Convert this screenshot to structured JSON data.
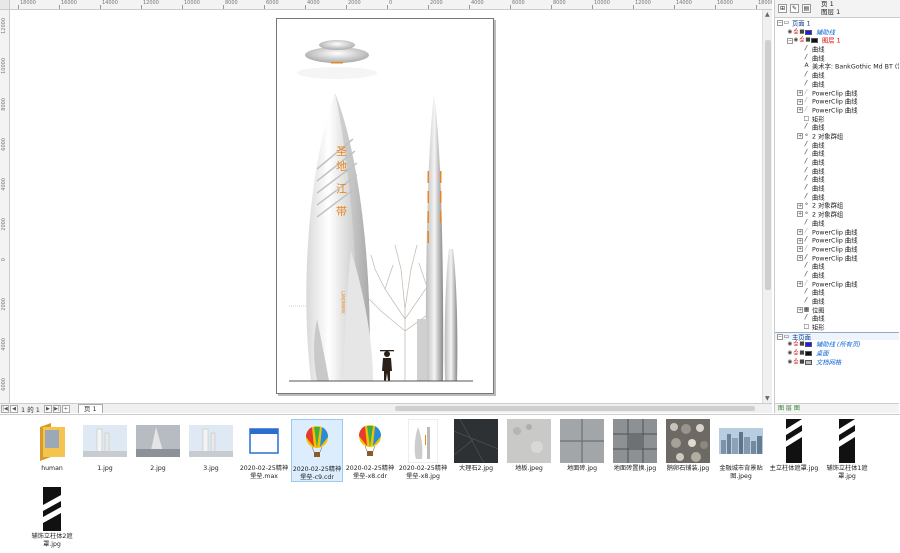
{
  "rulers": {
    "horizontal_labels": [
      "18000",
      "16000",
      "14000",
      "12000",
      "10000",
      "8000",
      "6000",
      "4000",
      "2000",
      "0",
      "2000",
      "4000",
      "6000",
      "8000",
      "10000",
      "12000",
      "14000",
      "16000",
      "18000"
    ],
    "vertical_labels": [
      "12000",
      "10000",
      "8000",
      "6000",
      "4000",
      "2000",
      "0",
      "2000",
      "4000",
      "6000"
    ]
  },
  "artwork": {
    "title_text": "圣地 江 带",
    "side_text": "LANDMARK"
  },
  "page_nav": {
    "counter": "1 的 1",
    "tab_label": "页 1"
  },
  "object_manager": {
    "page_label": "页 1",
    "layer_label": "图层 1",
    "rows": [
      {
        "type": "page",
        "label": "页面 1",
        "expander": "−",
        "icon": "page"
      },
      {
        "type": "layer",
        "label": "辅助线",
        "style": "blue",
        "swatch": "#1a1aff"
      },
      {
        "type": "layer",
        "label": "图层 1",
        "style": "red",
        "swatch": "#111111",
        "expander": "−"
      },
      {
        "type": "obj",
        "label": "曲线",
        "icon": "curve"
      },
      {
        "type": "obj",
        "label": "曲线",
        "icon": "curve"
      },
      {
        "type": "obj",
        "label": "美术字: BankGothic Md BT (常规",
        "icon": "text"
      },
      {
        "type": "obj",
        "label": "曲线",
        "icon": "curve"
      },
      {
        "type": "obj",
        "label": "曲线",
        "icon": "curve"
      },
      {
        "type": "obj",
        "label": "PowerClip 曲线",
        "icon": "curve-light",
        "expander": "+"
      },
      {
        "type": "obj",
        "label": "PowerClip 曲线",
        "icon": "curve-light",
        "expander": "+"
      },
      {
        "type": "obj",
        "label": "PowerClip 曲线",
        "icon": "curve-light",
        "expander": "+"
      },
      {
        "type": "obj",
        "label": "矩形",
        "icon": "rect"
      },
      {
        "type": "obj",
        "label": "曲线",
        "icon": "curve"
      },
      {
        "type": "obj",
        "label": "2 对象群组",
        "icon": "group",
        "expander": "+"
      },
      {
        "type": "obj",
        "label": "曲线",
        "icon": "curve"
      },
      {
        "type": "obj",
        "label": "曲线",
        "icon": "curve"
      },
      {
        "type": "obj",
        "label": "曲线",
        "icon": "curve"
      },
      {
        "type": "obj",
        "label": "曲线",
        "icon": "curve"
      },
      {
        "type": "obj",
        "label": "曲线",
        "icon": "curve"
      },
      {
        "type": "obj",
        "label": "曲线",
        "icon": "curve"
      },
      {
        "type": "obj",
        "label": "曲线",
        "icon": "curve"
      },
      {
        "type": "obj",
        "label": "2 对象群组",
        "icon": "group",
        "expander": "+"
      },
      {
        "type": "obj",
        "label": "2 对象群组",
        "icon": "group",
        "expander": "+"
      },
      {
        "type": "obj",
        "label": "曲线",
        "icon": "curve"
      },
      {
        "type": "obj",
        "label": "PowerClip 曲线",
        "icon": "curve-light",
        "expander": "+"
      },
      {
        "type": "obj",
        "label": "PowerClip 曲线",
        "icon": "curve",
        "expander": "+"
      },
      {
        "type": "obj",
        "label": "PowerClip 曲线",
        "icon": "curve-light",
        "expander": "+"
      },
      {
        "type": "obj",
        "label": "PowerClip 曲线",
        "icon": "curve",
        "expander": "+"
      },
      {
        "type": "obj",
        "label": "曲线",
        "icon": "curve"
      },
      {
        "type": "obj",
        "label": "曲线",
        "icon": "curve"
      },
      {
        "type": "obj",
        "label": "PowerClip 曲线",
        "icon": "curve-light",
        "expander": "+"
      },
      {
        "type": "obj",
        "label": "曲线",
        "icon": "curve"
      },
      {
        "type": "obj",
        "label": "曲线",
        "icon": "curve"
      },
      {
        "type": "obj",
        "label": "位图",
        "icon": "bitmap",
        "expander": "+"
      },
      {
        "type": "obj",
        "label": "曲线",
        "icon": "curve"
      },
      {
        "type": "obj",
        "label": "矩形",
        "icon": "rect"
      },
      {
        "type": "master",
        "label": "主页面",
        "expander": "−",
        "icon": "page"
      },
      {
        "type": "layer",
        "label": "辅助线 (所有页)",
        "style": "blue",
        "swatch": "#1a1aff"
      },
      {
        "type": "layer",
        "label": "桌面",
        "style": "blue",
        "swatch": "#111111"
      },
      {
        "type": "layer",
        "label": "文档网格",
        "style": "blue",
        "swatch": "#bbbbbb"
      }
    ],
    "bottom_label": "图 层 图"
  },
  "files": [
    {
      "name": "human",
      "thumb": "folder"
    },
    {
      "name": "1.jpg",
      "thumb": "photo-sky"
    },
    {
      "name": "2.jpg",
      "thumb": "photo-grey"
    },
    {
      "name": "3.jpg",
      "thumb": "photo-sky"
    },
    {
      "name": "2020-02-25精神堡垒.max",
      "thumb": "window"
    },
    {
      "name": "2020-02-25精神堡垒-c9.cdr",
      "thumb": "balloon",
      "selected": true
    },
    {
      "name": "2020-02-25精神堡垒-x8.cdr",
      "thumb": "balloon"
    },
    {
      "name": "2020-02-25精神堡垒-x8.jpg",
      "thumb": "tower"
    },
    {
      "name": "大理石2.jpg",
      "thumb": "marble-dark"
    },
    {
      "name": "地板.jpeg",
      "thumb": "stone-light"
    },
    {
      "name": "地面砖.jpg",
      "thumb": "tiles"
    },
    {
      "name": "地面砖置换.jpg",
      "thumb": "tiles-dark"
    },
    {
      "name": "鹅卵石铺装.jpg",
      "thumb": "pebbles"
    },
    {
      "name": "金融城市背景贴图.jpeg",
      "thumb": "city"
    },
    {
      "name": "主立柱体遮罩.jpg",
      "thumb": "stripe-tall"
    },
    {
      "name": "辅饰立柱体1遮罩.jpg",
      "thumb": "stripe-tall"
    },
    {
      "name": "辅饰立柱体2遮罩.jpg",
      "thumb": "stripe-square"
    }
  ],
  "colors": {
    "accent_orange": "#e8871e",
    "selection_blue": "#0a64d8",
    "layer_red": "#e00000"
  }
}
